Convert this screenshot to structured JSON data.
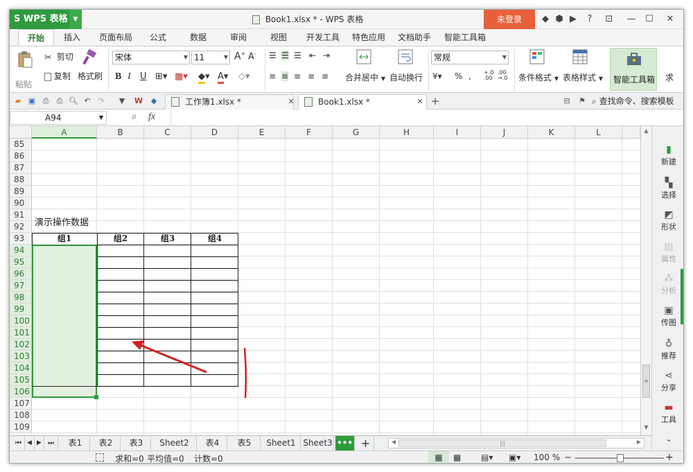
{
  "app": {
    "name": "WPS 表格",
    "doc_title": "Book1.xlsx * - WPS 表格",
    "login": "未登录"
  },
  "menu": [
    "开始",
    "插入",
    "页面布局",
    "公式",
    "数据",
    "审阅",
    "视图",
    "开发工具",
    "特色应用",
    "文档助手",
    "智能工具箱"
  ],
  "ribbon": {
    "paste": "粘贴",
    "cut": "剪切",
    "copy": "复制",
    "format_painter": "格式刷",
    "font": "宋体",
    "size": "11",
    "merge": "合并居中",
    "wrap": "自动换行",
    "number_format": "常规",
    "cond_format": "条件格式",
    "table_style": "表格样式",
    "smart_toolbox": "智能工具箱",
    "sum": "求"
  },
  "doc_tabs": [
    "工作簿1.xlsx *",
    "Book1.xlsx *"
  ],
  "search_label": "查找命令、搜索模板",
  "name_box": "A94",
  "fx": "fx",
  "columns": [
    "A",
    "B",
    "C",
    "D",
    "E",
    "F",
    "G",
    "H",
    "I",
    "J",
    "K",
    "L"
  ],
  "rows": [
    "85",
    "86",
    "87",
    "88",
    "89",
    "90",
    "91",
    "92",
    "93",
    "94",
    "95",
    "96",
    "97",
    "98",
    "99",
    "100",
    "101",
    "102",
    "103",
    "104",
    "105",
    "106",
    "107",
    "108",
    "109"
  ],
  "cell_A91": "演示操作数据",
  "table_headers": [
    "组1",
    "组2",
    "组3",
    "组4"
  ],
  "sidebar": [
    "新建",
    "选择",
    "形状",
    "属性",
    "分析",
    "传图",
    "推荐",
    "分享",
    "工具"
  ],
  "sheets": [
    "表1",
    "表2",
    "表3",
    "Sheet2",
    "表4",
    "表5",
    "Sheet1",
    "Sheet3"
  ],
  "status": {
    "sum": "求和=0",
    "avg": "平均值=0",
    "count": "计数=0",
    "zoom": "100 %"
  },
  "colors": {
    "accent": "#2e9b3c",
    "login": "#e8603c",
    "selection": "#e2f1df",
    "arrow": "#d42020"
  }
}
